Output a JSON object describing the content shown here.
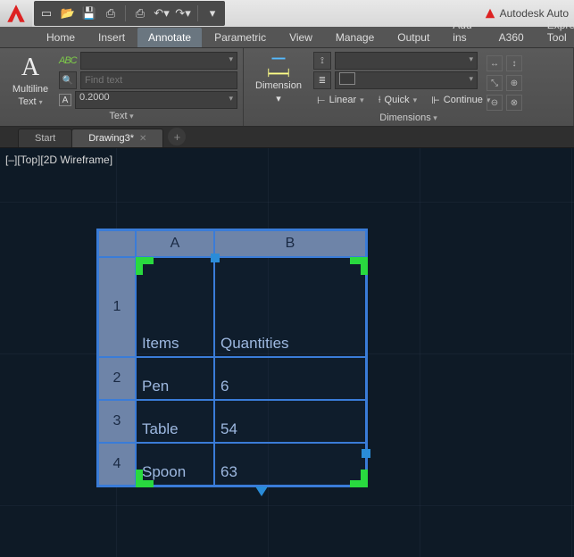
{
  "title_right": "Autodesk Auto",
  "menu": {
    "tabs": [
      "Home",
      "Insert",
      "Annotate",
      "Parametric",
      "View",
      "Manage",
      "Output",
      "Add-ins",
      "A360",
      "Express Tool"
    ],
    "active": 2
  },
  "ribbon": {
    "text_panel": {
      "title": "Text",
      "multiline_label": "Multiline",
      "multiline_sub": "Text",
      "find_placeholder": "Find text",
      "height_value": "0.2000"
    },
    "dim_panel": {
      "title": "Dimensions",
      "big_label": "Dimension",
      "linear": "Linear",
      "quick": "Quick",
      "continue": "Continue"
    }
  },
  "doctabs": {
    "items": [
      {
        "label": "Start",
        "active": false
      },
      {
        "label": "Drawing3*",
        "active": true
      }
    ]
  },
  "view_label": "[–][Top][2D Wireframe]",
  "table": {
    "col_headers": [
      "A",
      "B"
    ],
    "row_headers": [
      "1",
      "2",
      "3",
      "4"
    ],
    "rows": [
      {
        "a": "Items",
        "b": "Quantities"
      },
      {
        "a": "Pen",
        "b": "6"
      },
      {
        "a": "Table",
        "b": "54"
      },
      {
        "a": "Spoon",
        "b": "63"
      }
    ]
  }
}
